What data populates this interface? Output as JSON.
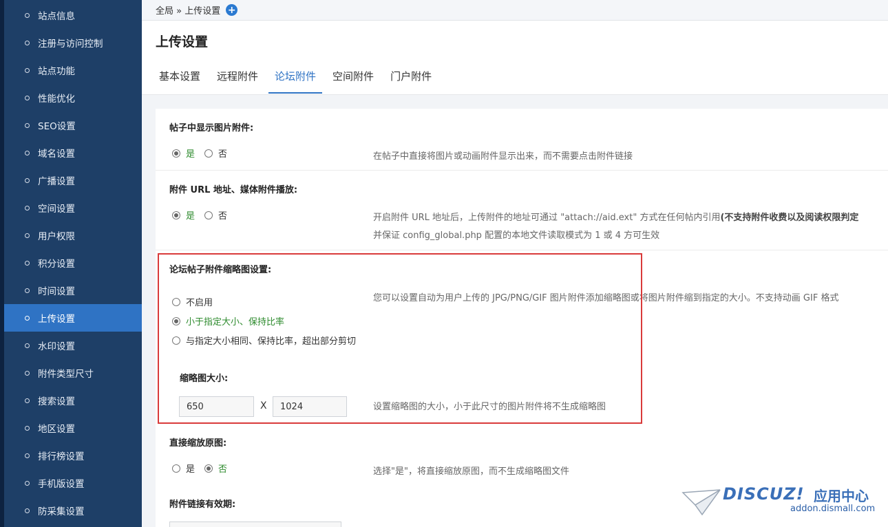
{
  "sidebar": {
    "items": [
      {
        "label": "站点信息"
      },
      {
        "label": "注册与访问控制"
      },
      {
        "label": "站点功能"
      },
      {
        "label": "性能优化"
      },
      {
        "label": "SEO设置"
      },
      {
        "label": "域名设置"
      },
      {
        "label": "广播设置"
      },
      {
        "label": "空间设置"
      },
      {
        "label": "用户权限"
      },
      {
        "label": "积分设置"
      },
      {
        "label": "时间设置"
      },
      {
        "label": "上传设置",
        "active": true
      },
      {
        "label": "水印设置"
      },
      {
        "label": "附件类型尺寸"
      },
      {
        "label": "搜索设置"
      },
      {
        "label": "地区设置"
      },
      {
        "label": "排行榜设置"
      },
      {
        "label": "手机版设置"
      },
      {
        "label": "防采集设置"
      }
    ]
  },
  "breadcrumb": {
    "text": "全局 » 上传设置",
    "add_icon": "+"
  },
  "page": {
    "title": "上传设置"
  },
  "tabs": [
    {
      "label": "基本设置"
    },
    {
      "label": "远程附件"
    },
    {
      "label": "论坛附件",
      "active": true
    },
    {
      "label": "空间附件"
    },
    {
      "label": "门户附件"
    }
  ],
  "settings": {
    "show_image": {
      "title": "帖子中显示图片附件:",
      "yes": "是",
      "no": "否",
      "selected": "yes",
      "desc": "在帖子中直接将图片或动画附件显示出来，而不需要点击附件链接"
    },
    "attach_url": {
      "title": "附件 URL 地址、媒体附件播放:",
      "yes": "是",
      "no": "否",
      "selected": "yes",
      "desc1": "开启附件 URL 地址后，上传附件的地址可通过 \"attach://aid.ext\" 方式在任何帖内引用",
      "desc1_bold": "(不支持附件收费以及阅读权限判定",
      "desc2": "并保证 config_global.php 配置的本地文件读取模式为 1 或 4 方可生效"
    },
    "thumb": {
      "title": "论坛帖子附件缩略图设置:",
      "options": [
        "不启用",
        "小于指定大小、保持比率",
        "与指定大小相同、保持比率，超出部分剪切"
      ],
      "selected_index": 1,
      "desc": "您可以设置自动为用户上传的 JPG/PNG/GIF 图片附件添加缩略图或将图片附件缩到指定的大小。不支持动画 GIF 格式",
      "size_title": "缩略图大小:",
      "width": "650",
      "x_label": "X",
      "height": "1024",
      "size_desc": "设置缩略图的大小，小于此尺寸的图片附件将不生成缩略图"
    },
    "direct_scale": {
      "title": "直接缩放原图:",
      "yes": "是",
      "no": "否",
      "selected": "no",
      "desc": "选择\"是\"，将直接缩放原图，而不生成缩略图文件"
    },
    "link_expire": {
      "title": "附件链接有效期:"
    }
  },
  "watermark": {
    "brand": "DISCUZ!",
    "cn": "应用中心",
    "url": "addon.dismall.com"
  },
  "colors": {
    "sidebar_bg": "#1e3f67",
    "active": "#2f73c4",
    "selected_text": "#2e8b2e",
    "highlight_border": "#d93a3a"
  }
}
